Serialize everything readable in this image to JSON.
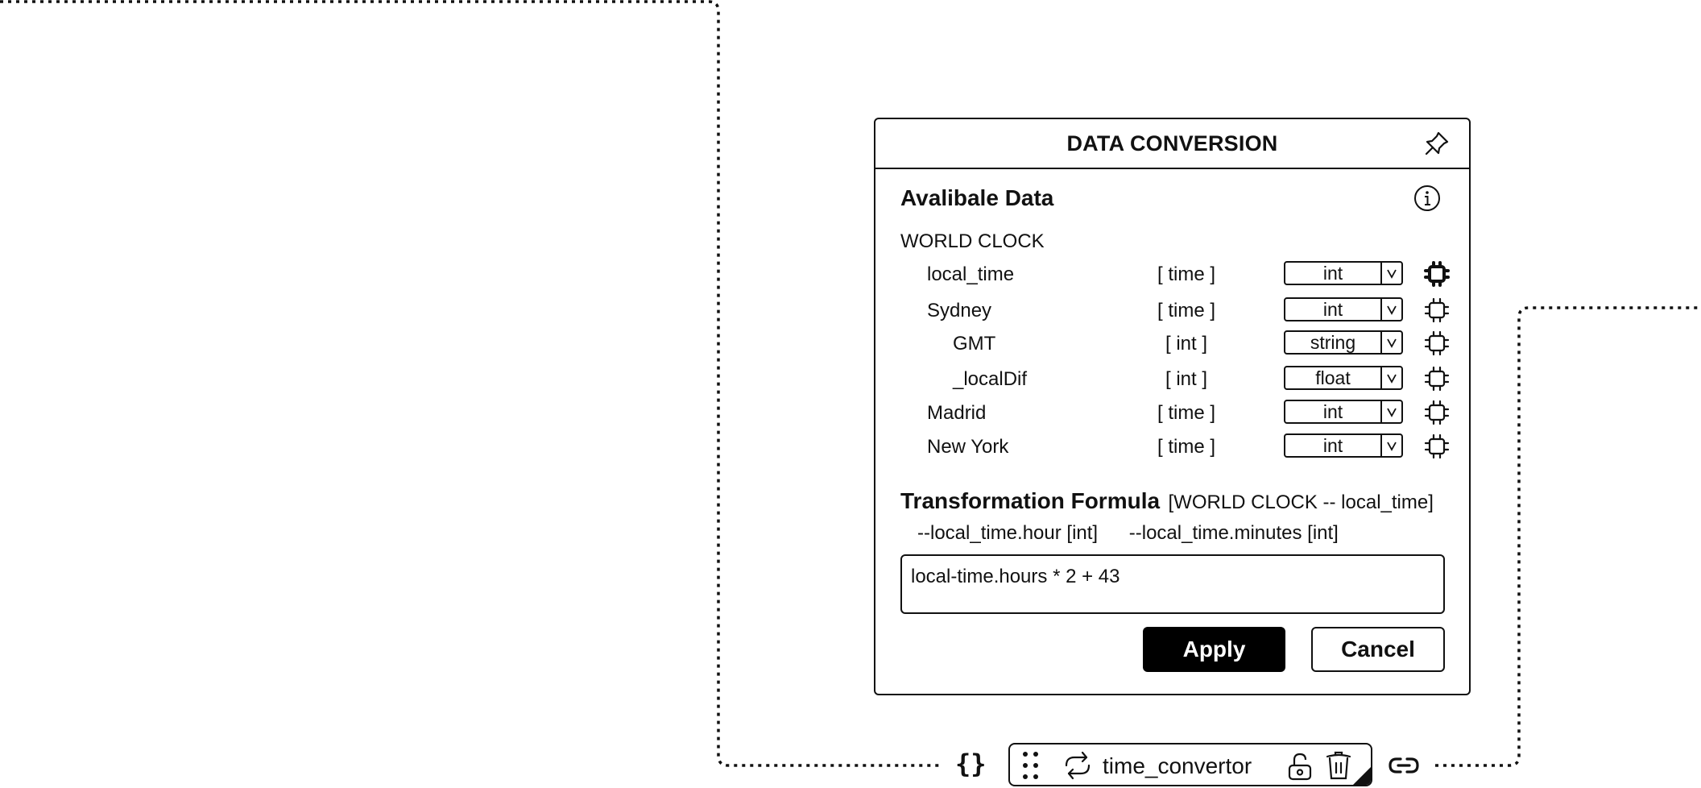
{
  "panel": {
    "title": "DATA CONVERSION",
    "available_title": "Avalibale Data",
    "group": "WORLD CLOCK",
    "rows": [
      {
        "name": "local_time",
        "type": "[ time ]",
        "select": "int",
        "level": 1,
        "active": true
      },
      {
        "name": "Sydney",
        "type": "[ time ]",
        "select": "int",
        "level": 1,
        "active": false
      },
      {
        "name": "GMT",
        "type": "[ int ]",
        "select": "string",
        "level": 2,
        "active": false
      },
      {
        "name": "_localDif",
        "type": "[ int ]",
        "select": "float",
        "level": 2,
        "active": false
      },
      {
        "name": "Madrid",
        "type": "[ time ]",
        "select": "int",
        "level": 1,
        "active": false
      },
      {
        "name": "New York",
        "type": "[ time ]",
        "select": "int",
        "level": 1,
        "active": false
      }
    ],
    "formula": {
      "title": "Transformation Formula",
      "context": "[WORLD CLOCK -- local_time]",
      "hints": [
        "--local_time.hour [int]",
        "--local_time.minutes [int]"
      ],
      "value": "local-time.hours * 2 + 43"
    },
    "apply_label": "Apply",
    "cancel_label": "Cancel"
  },
  "node": {
    "braces": "{}",
    "label": "time_convertor"
  },
  "icons": {
    "pin": "pin-icon",
    "info": "info-icon",
    "chip": "chip-icon",
    "drag": "drag-handle-icon",
    "sync": "sync-icon",
    "lock": "lock-icon",
    "trash": "trash-icon",
    "link": "link-icon"
  }
}
